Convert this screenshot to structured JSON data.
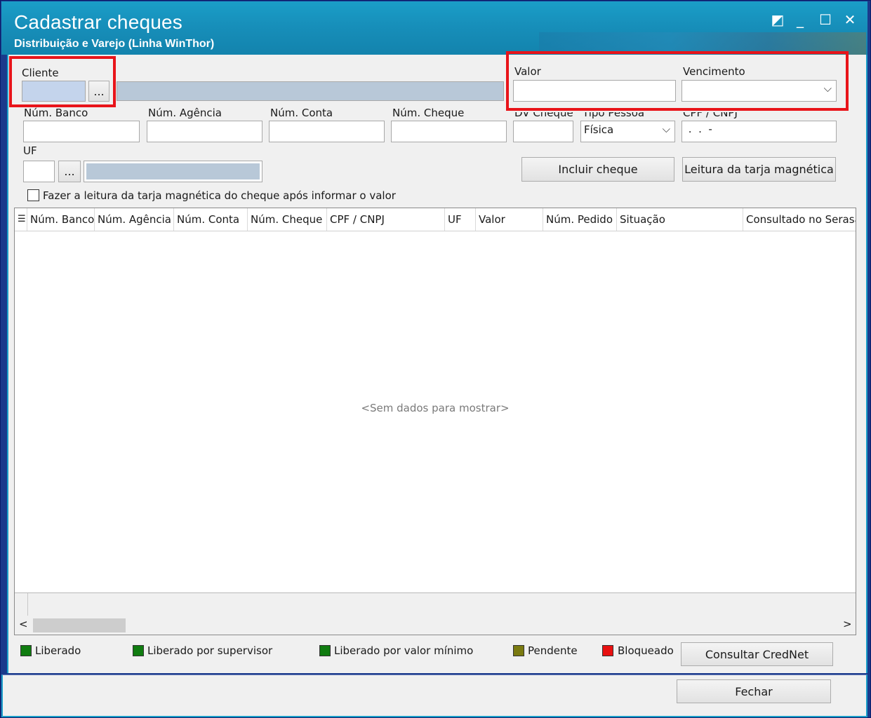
{
  "window": {
    "title": "Cadastrar cheques",
    "subtitle": "Distribuição e Varejo (Linha WinThor)",
    "restore_glyph": "◩",
    "minimize_glyph": "_",
    "maximize_glyph": "☐",
    "close_glyph": "✕"
  },
  "form": {
    "cliente_label": "Cliente",
    "cliente_lookup": "...",
    "valor_label": "Valor",
    "vencimento_label": "Vencimento",
    "num_banco_label": "Núm. Banco",
    "num_agencia_label": "Núm. Agência",
    "num_conta_label": "Núm. Conta",
    "num_cheque_label": "Núm. Cheque",
    "dv_cheque_label": "DV Cheque",
    "tipo_pessoa_label": "Tipo Pessoa",
    "tipo_pessoa_value": "Física",
    "cpf_cnpj_label": "CPF / CNPJ",
    "cpf_cnpj_mask": " .  .  -",
    "uf_label": "UF",
    "uf_lookup": "...",
    "incluir_cheque": "Incluir cheque",
    "leitura_tarja": "Leitura da tarja magnética",
    "checkbox_label": "Fazer a leitura da tarja magnética do cheque após informar o valor"
  },
  "grid": {
    "columns": [
      "Núm. Banco",
      "Núm. Agência",
      "Núm. Conta",
      "Núm. Cheque",
      "CPF / CNPJ",
      "UF",
      "Valor",
      "Núm. Pedido",
      "Situação",
      "Consultado no Serasa"
    ],
    "empty_message": "<Sem dados para mostrar>",
    "scroll_left": "<",
    "scroll_right": ">"
  },
  "legend": {
    "items": [
      {
        "label": "Liberado",
        "color": "#107c10"
      },
      {
        "label": "Liberado por supervisor",
        "color": "#107c10"
      },
      {
        "label": "Liberado por valor mínimo",
        "color": "#107c10"
      },
      {
        "label": "Pendente",
        "color": "#7a7a10"
      },
      {
        "label": "Bloqueado",
        "color": "#e81010"
      }
    ],
    "consultar_credenet": "Consultar CredNet"
  },
  "footer": {
    "fechar": "Fechar"
  },
  "colors": {
    "titlebar": "#178fba",
    "highlight": "#e8141a",
    "client_bg": "#f0f0f0"
  }
}
